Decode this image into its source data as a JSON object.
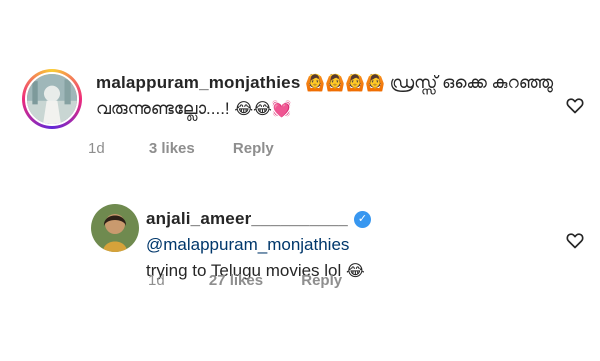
{
  "comments": [
    {
      "username": "malappuram_monjathies",
      "emoji_prefix": "🙆🙆🙆🙆",
      "text_line1": "ഡ്രസ്സ് ഒക്കെ കുറഞ്ഞു",
      "text_line2": "വരുന്നുണ്ടല്ലോ....!",
      "emoji_suffix": "😂😂💓",
      "time": "1d",
      "likes": "3 likes",
      "reply": "Reply",
      "avatar_ring": true
    },
    {
      "username": "anjali_ameer__________",
      "verified": true,
      "mention": "@malappuram_monjathies",
      "text": "trying to Telugu movies  lol",
      "emoji_suffix": "😂",
      "time": "1d",
      "likes": "27 likes",
      "reply": "Reply",
      "avatar_ring": false
    }
  ],
  "icons": {
    "like": "heart-outline-icon",
    "verified": "verified-badge-icon"
  },
  "colors": {
    "verified": "#3897f0",
    "meta": "#8e8e8e",
    "mention": "#00376b"
  }
}
